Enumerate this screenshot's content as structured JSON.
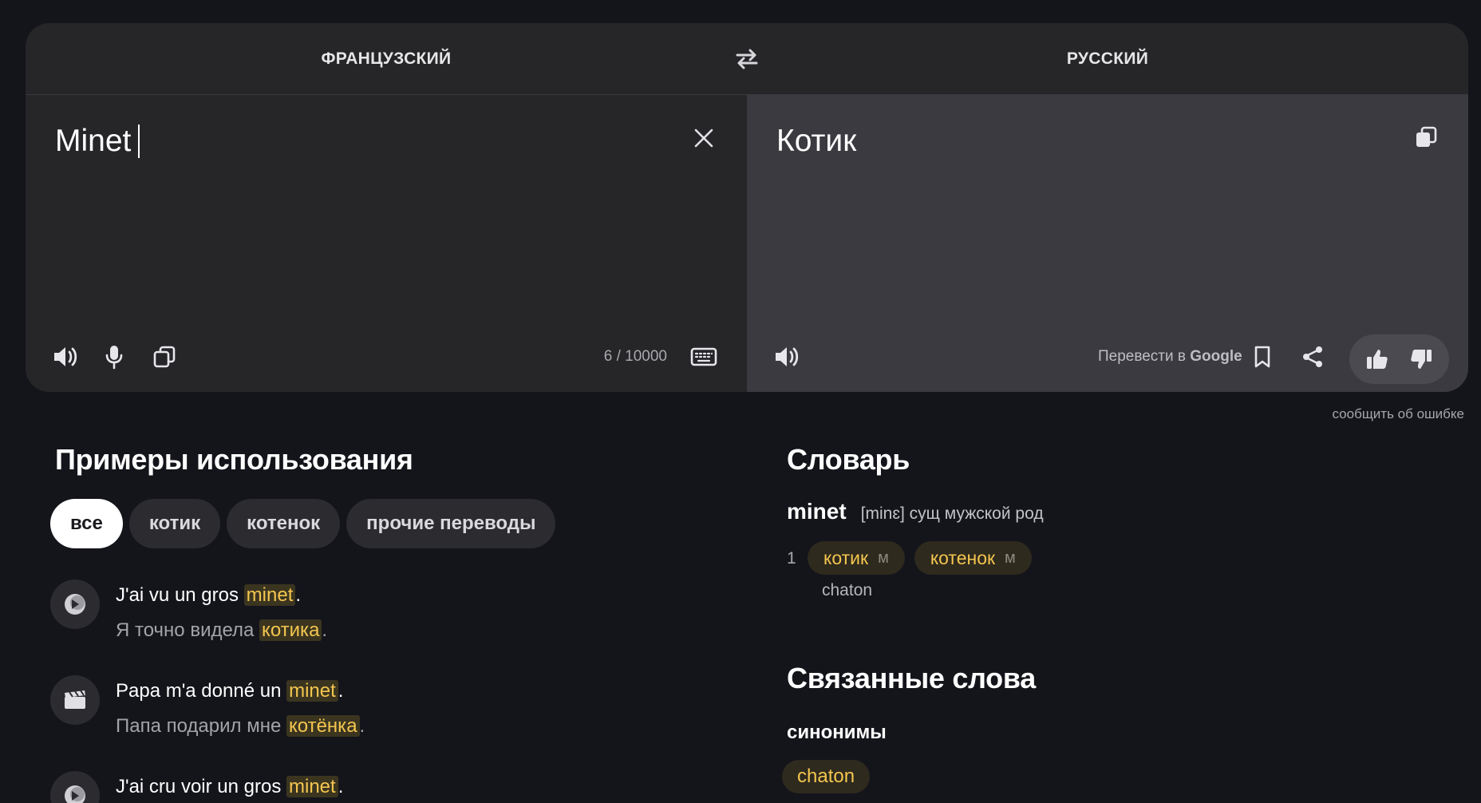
{
  "languages": {
    "source": "ФРАНЦУЗСКИЙ",
    "target": "РУССКИЙ"
  },
  "source": {
    "text": "Minet",
    "counter": "6 / 10000"
  },
  "target": {
    "text": "Котик",
    "google_prefix": "Перевести в ",
    "google_brand": "Google"
  },
  "report_error": "сообщить об ошибке",
  "examples": {
    "title": "Примеры использования",
    "filters": [
      "все",
      "котик",
      "котенок",
      "прочие переводы"
    ],
    "active_filter": "все",
    "items": [
      {
        "source_icon": "video-icon",
        "fr_before": "J'ai vu un gros ",
        "fr_hl": "minet",
        "fr_after": ".",
        "ru_before": "Я точно видела ",
        "ru_hl": "котика",
        "ru_after": "."
      },
      {
        "source_icon": "clapperboard-icon",
        "fr_before": "Papa m'a donné un ",
        "fr_hl": "minet",
        "fr_after": ".",
        "ru_before": "Папа подарил мне ",
        "ru_hl": "котёнка",
        "ru_after": "."
      },
      {
        "source_icon": "video-icon",
        "fr_before": "J'ai cru voir un gros ",
        "fr_hl": "minet",
        "fr_after": ".",
        "ru_before": "",
        "ru_hl": "",
        "ru_after": ""
      }
    ]
  },
  "dictionary": {
    "title": "Словарь",
    "word": "minet",
    "transcription": "[minɛ]",
    "pos": "сущ",
    "gender": "мужской род",
    "num": "1",
    "translations": [
      {
        "word": "котик",
        "gender": "м"
      },
      {
        "word": "котенок",
        "gender": "м"
      }
    ],
    "source_synonym": "chaton"
  },
  "related": {
    "title": "Связанные слова",
    "synonyms_label": "синонимы",
    "synonyms": [
      "chaton"
    ]
  },
  "colors": {
    "background": "#14151b",
    "panel": "#262629",
    "result_panel": "#3b3a40",
    "highlight": "#f4c64f"
  }
}
